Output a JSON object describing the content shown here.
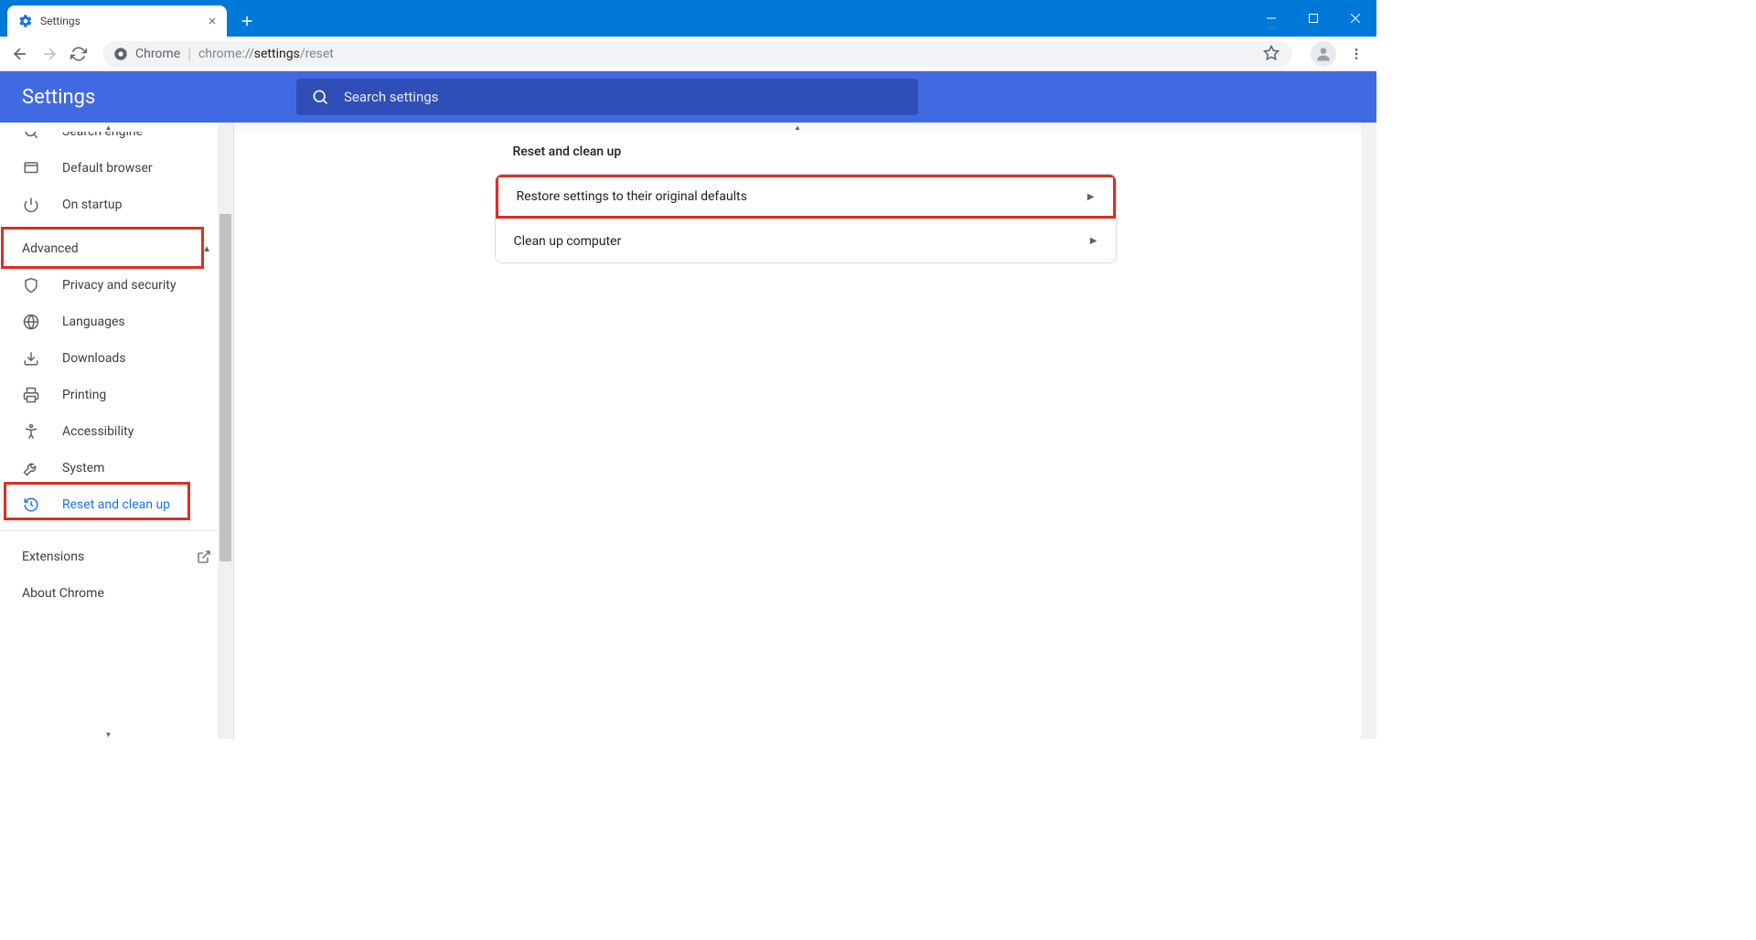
{
  "window": {
    "tab_title": "Settings"
  },
  "toolbar": {
    "origin": "Chrome",
    "url_prefix": "chrome://",
    "url_bold": "settings",
    "url_suffix": "/reset"
  },
  "header": {
    "title": "Settings",
    "search_placeholder": "Search settings"
  },
  "sidebar": {
    "items": [
      {
        "label": "Search engine"
      },
      {
        "label": "Default browser"
      },
      {
        "label": "On startup"
      }
    ],
    "advanced_label": "Advanced",
    "advanced_items": [
      {
        "label": "Privacy and security"
      },
      {
        "label": "Languages"
      },
      {
        "label": "Downloads"
      },
      {
        "label": "Printing"
      },
      {
        "label": "Accessibility"
      },
      {
        "label": "System"
      },
      {
        "label": "Reset and clean up"
      }
    ],
    "extensions_label": "Extensions",
    "about_label": "About Chrome"
  },
  "main": {
    "section_title": "Reset and clean up",
    "rows": [
      {
        "label": "Restore settings to their original defaults"
      },
      {
        "label": "Clean up computer"
      }
    ]
  }
}
